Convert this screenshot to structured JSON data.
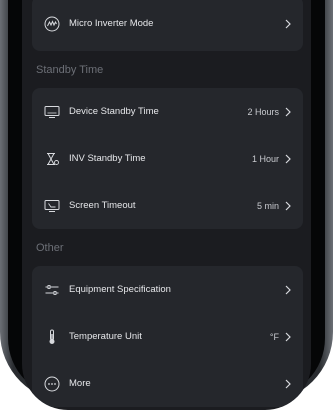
{
  "items": {
    "micro_inverter": {
      "label": "Micro Inverter Mode"
    },
    "standby_header": "Standby Time",
    "device_standby": {
      "label": "Device Standby Time",
      "value": "2 Hours"
    },
    "inv_standby": {
      "label": "INV Standby Time",
      "value": "1 Hour"
    },
    "screen_timeout": {
      "label": "Screen Timeout",
      "value": "5 min"
    },
    "other_header": "Other",
    "equipment_spec": {
      "label": "Equipment Specification"
    },
    "temperature_unit": {
      "label": "Temperature Unit",
      "value": "°F"
    },
    "more": {
      "label": "More"
    }
  },
  "colors": {
    "background": "#1b1c20",
    "card": "#25272c",
    "text": "#e6e7ea",
    "muted": "#6c6f76"
  }
}
